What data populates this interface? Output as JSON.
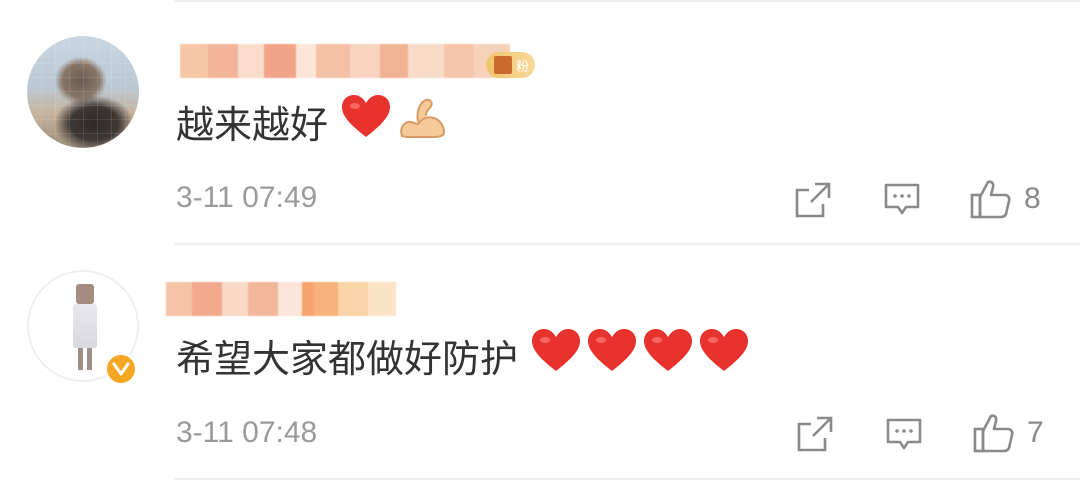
{
  "comments": [
    {
      "text": "越来越好",
      "emojis": [
        "red-heart",
        "flexed-biceps"
      ],
      "timestamp": "3-11 07:49",
      "likes": "8",
      "fan_badge_label": "粉",
      "verified": false
    },
    {
      "text": "希望大家都做好防护",
      "emojis": [
        "red-heart",
        "red-heart",
        "red-heart",
        "red-heart"
      ],
      "timestamp": "3-11 07:48",
      "likes": "7",
      "verified": true
    }
  ],
  "actions": [
    "share-icon",
    "reply-icon",
    "like-icon"
  ],
  "colors": {
    "text": "#333333",
    "meta": "#9a9a9a",
    "heart": "#e8322d",
    "verify_badge": "#f5a623",
    "fan_badge": "#f0c36b",
    "divider": "#ececec"
  }
}
